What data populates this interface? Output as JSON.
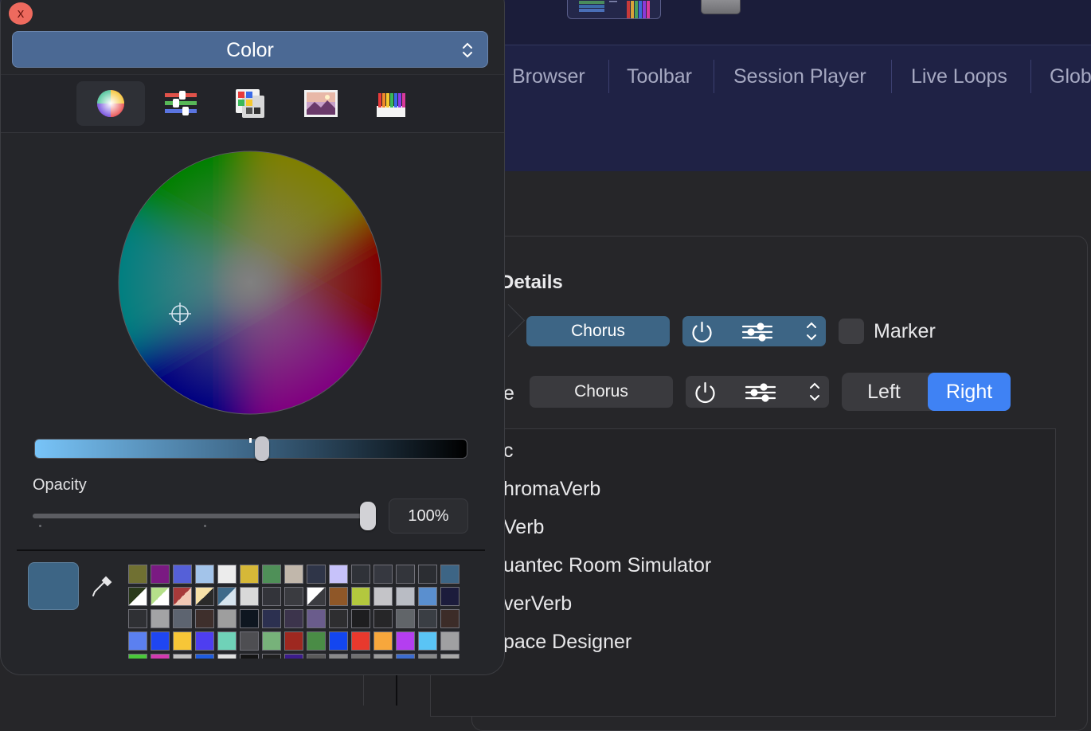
{
  "tabs": [
    {
      "label": "Browser"
    },
    {
      "label": "Toolbar"
    },
    {
      "label": "Session Player"
    },
    {
      "label": "Live Loops"
    },
    {
      "label": "Glob"
    }
  ],
  "details": {
    "heading": "Details",
    "row1": {
      "plugin": "Chorus",
      "checkbox_label": "Marker"
    },
    "row2": {
      "stub_text": "e",
      "plugin": "Chorus",
      "segment": {
        "left": "Left",
        "right": "Right",
        "selected": "Right"
      }
    }
  },
  "plugin_list": [
    "c",
    "hromaVerb",
    "Verb",
    "uantec Room Simulator",
    "verVerb",
    "pace Designer"
  ],
  "color_panel": {
    "close_label": "x",
    "mode": "Color",
    "tools": [
      {
        "icon": "color-wheel-icon",
        "active": true
      },
      {
        "icon": "color-sliders-icon",
        "active": false
      },
      {
        "icon": "color-palettes-icon",
        "active": false
      },
      {
        "icon": "image-palettes-icon",
        "active": false
      },
      {
        "icon": "pencils-icon",
        "active": false
      }
    ],
    "selected_color": "#3d6585",
    "brightness": 0.5,
    "opacity_label": "Opacity",
    "opacity_value": "100%",
    "swatches": [
      [
        "#707032",
        "#7a1a82",
        "#5560d8",
        "#a3c4ea",
        "#ececec",
        "#d6b838",
        "#4f9058",
        "#c1b7ab",
        "#2f3548",
        "#c7c2fa",
        "#2f3238",
        "#363840",
        "#33353b",
        "#2b2d32",
        "#3d6585"
      ],
      [
        "split:#2a3a1a:#ffffff",
        "split:#b5e08a:#ffffff",
        "split:#a83a3a:#f3c9b5",
        "split:#f7e1a8:#2a2a2a",
        "split:#3e6a8a:#d6e4ef",
        "#d9d9d9",
        "#33343a",
        "#3a3b40",
        "split:#ffffff:#3a3b40",
        "#8f5728",
        "#b3c83e",
        "#c4c4c8",
        "#b9bcc4",
        "#5a8fcf",
        "#1c1c3c"
      ],
      [
        "#2f3034",
        "#a3a3a5",
        "#5d6470",
        "#3e2f2c",
        "#9e9e9e",
        "#0e1620",
        "#2c3050",
        "#3c344c",
        "#6a5c8c",
        "#2e2e30",
        "#1e1e20",
        "#262628",
        "#616569",
        "#3a3e44",
        "#3c2c28"
      ],
      [
        "#5b80f0",
        "#1f46f2",
        "#f7c637",
        "#4e3ef0",
        "#6fd2b8",
        "#4e4e52",
        "#77b27a",
        "#9e2820",
        "#4a8c46",
        "#1346f0",
        "#e8392d",
        "#f7a73c",
        "#b43ef0",
        "#5ac4f5",
        "#a0a0a2"
      ],
      [
        "#4ac83a",
        "#d23ab0",
        "#c0c0c0",
        "#1e5ce0",
        "#e0e0e0",
        "#141414",
        "#202020",
        "#3c1c8c",
        "#5a5a5a",
        "#8a8a8a",
        "#707070",
        "#9a9a9a",
        "#3c6cd0",
        "#888888",
        "#a8a8a8"
      ]
    ]
  }
}
